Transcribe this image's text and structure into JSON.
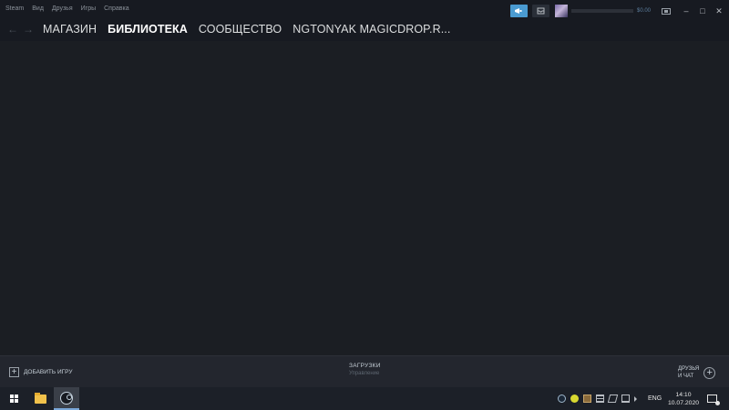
{
  "menu": {
    "items": [
      "Steam",
      "Вид",
      "Друзья",
      "Игры",
      "Справка"
    ]
  },
  "account": {
    "balance": "$0.00"
  },
  "nav": {
    "back_icon": "arrow-left-icon",
    "forward_icon": "arrow-right-icon",
    "links": [
      "МАГАЗИН",
      "БИБЛИОТЕКА",
      "СООБЩЕСТВО",
      "NGTONYAK MAGICDROP.R..."
    ],
    "active": "БИБЛИОТЕКА"
  },
  "footer": {
    "add_game": "ДОБАВИТЬ ИГРУ",
    "downloads_title": "ЗАГРУЗКИ",
    "downloads_sub": "Управление",
    "friends_line1": "ДРУЗЬЯ",
    "friends_line2": "И ЧАТ"
  },
  "taskbar": {
    "language": "ENG",
    "time": "14:10",
    "date": "10.07.2020"
  },
  "colors": {
    "window_bg": "#1b1e23",
    "titlebar_bg": "#171a21",
    "accent_blue": "#4a9bd1",
    "taskbar_bg": "#1c2028"
  }
}
